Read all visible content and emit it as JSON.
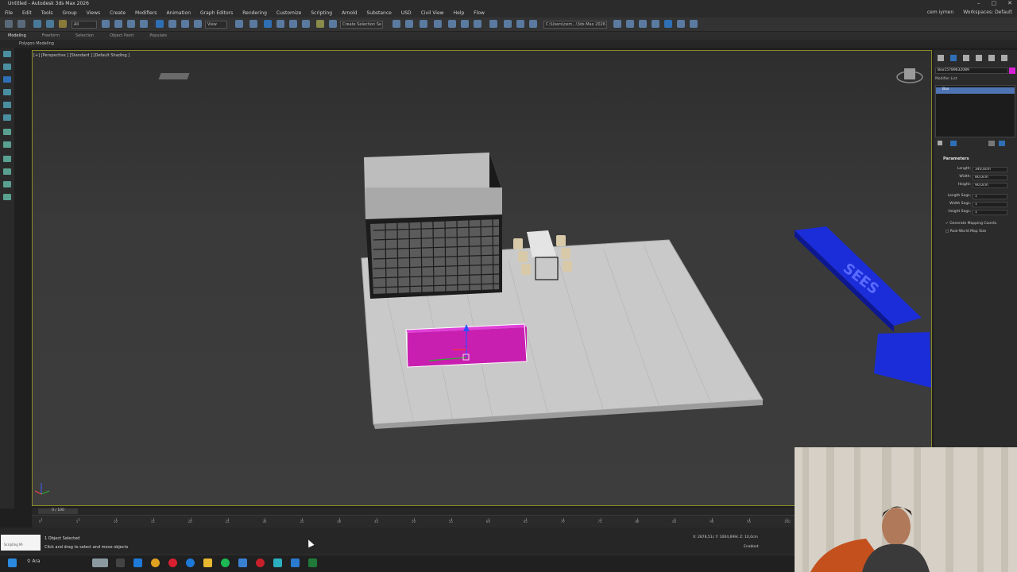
{
  "window": {
    "title": "Untitled - Autodesk 3ds Max 2026"
  },
  "menu": {
    "items": [
      "File",
      "Edit",
      "Tools",
      "Group",
      "Views",
      "Create",
      "Modifiers",
      "Animation",
      "Graph Editors",
      "Rendering",
      "Customize",
      "Scripting",
      "Arnold",
      "Substance",
      "USD",
      "Civil View",
      "Help",
      "Flow"
    ],
    "user": "cem iymen",
    "workspace_label": "Workspaces:",
    "workspace_value": "Default"
  },
  "toolbar": {
    "view_dropdown": "View",
    "selection_set": "Create Selection Se",
    "path": "C:\\Users\\cem...\\3ds Max 2026"
  },
  "ribbon": {
    "tabs": [
      "Modeling",
      "Freeform",
      "Selection",
      "Object Paint",
      "Populate"
    ],
    "sub": "Polygon Modeling"
  },
  "viewport": {
    "label": "[+] [Perspective ] [Standard ] [Default Shading ]",
    "signage_text": "SEES"
  },
  "command_panel": {
    "object_name": "Box15789632089",
    "modifier_list": "Modifier List",
    "stack_item": "Box",
    "params_title": "Parameters",
    "params": [
      {
        "label": "Length:",
        "value": "340,0cm"
      },
      {
        "label": "Width:",
        "value": "80,0cm"
      },
      {
        "label": "Height:",
        "value": "90,0cm"
      },
      {
        "label": "Length Segs:",
        "value": "1"
      },
      {
        "label": "Width Segs:",
        "value": "1"
      },
      {
        "label": "Height Segs:",
        "value": "1"
      }
    ],
    "generate_mapping": "Generate Mapping Coords.",
    "real_world": "Real-World Map Size"
  },
  "timeline": {
    "frame": "0 / 100",
    "ticks": [
      "0",
      "5",
      "10",
      "15",
      "20",
      "25",
      "30",
      "35",
      "40",
      "45",
      "50",
      "55",
      "60",
      "65",
      "70",
      "75",
      "80",
      "85",
      "90",
      "95",
      "100"
    ]
  },
  "status": {
    "prompt_label": "Scripting Mi",
    "selected": "1 Object Selected",
    "hint": "Click and drag to select and move objects",
    "coords": "X: 2878,51c  Y: 1004,699c  Z: 10,0cm",
    "enabled": "Enabled:"
  },
  "taskbar": {
    "search": "Ara"
  },
  "colors": {
    "accent": "#4f74b3",
    "selected_object": "#c81fb0",
    "signage": "#1a2dd8"
  }
}
